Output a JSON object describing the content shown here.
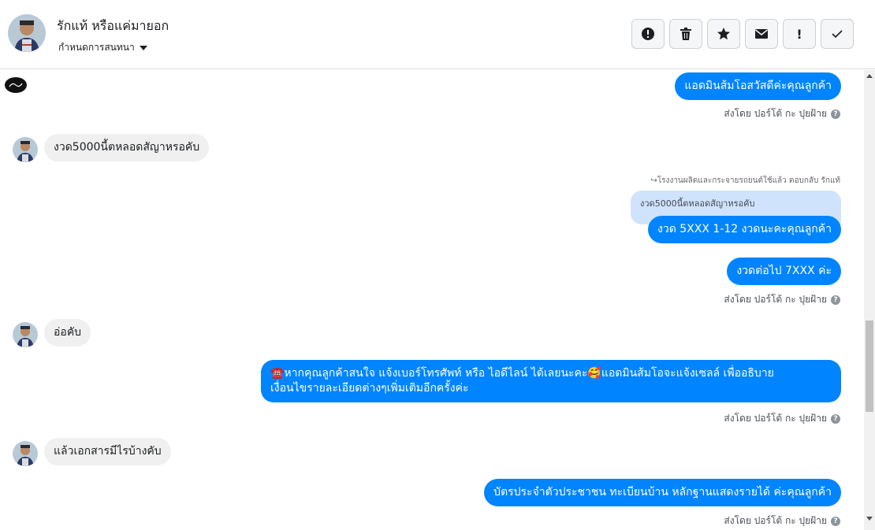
{
  "header": {
    "contact_name": "รักแท้ หรือแค่มายอก",
    "assign_label": "กำหนดการสนทนา"
  },
  "toolbar": {
    "buttons": [
      {
        "icon": "alert-circle-icon"
      },
      {
        "icon": "trash-icon"
      },
      {
        "icon": "star-icon"
      },
      {
        "icon": "envelope-icon"
      },
      {
        "icon": "exclamation-icon",
        "label": "!"
      },
      {
        "icon": "check-icon"
      }
    ]
  },
  "sent_by": "ส่งโดย ปอร์โต้ กะ ปุยฝ้าย",
  "messages": [
    {
      "side": "out",
      "text": "แอดมินส้มโอสวัสดีค่ะคุณลูกค้า"
    },
    {
      "side": "in",
      "text": "งวด5000นี้ตหลอดสัญาหรอคับ"
    },
    {
      "side": "out",
      "reply_header": "โรงงานผลิตและกระจายรถยนต์ใช้แล้ว ตอบกลับ รักแท้",
      "quoted": "งวด5000นี้ตหลอดสัญาหรอคับ",
      "text": "งวด 5XXX  1-12 งวดนะคะคุณลูกค้า"
    },
    {
      "side": "out",
      "text": "งวดต่อไป 7XXX ค่ะ"
    },
    {
      "side": "in",
      "text": "อ่อคับ"
    },
    {
      "side": "out",
      "line1": "☎️หากคุณลูกค้าสนใจ แจ้งเบอร์โทรศัพท์ หรือ ไอดีไลน์  ได้เลยนะคะ🥰แอดมินส้มโอจะแจ้งเซลล์   เพื่ออธิบาย",
      "line2": "เงื่อนไขรายละเอียดต่างๆเพิ่มเติมอีกครั้งค่ะ"
    },
    {
      "side": "in",
      "text": "แล้วเอกสารมีไรบ้างคับ"
    },
    {
      "side": "out",
      "text": "บัตรประจำตัวประชาชน ทะเบียนบ้าน หลักฐานแสดงรายได้ ค่ะคุณลูกค้า"
    }
  ],
  "colors": {
    "outgoing_bubble": "#0084ff",
    "incoming_bubble": "#f0f0f0",
    "quote_bubble": "#cfe3fc"
  }
}
